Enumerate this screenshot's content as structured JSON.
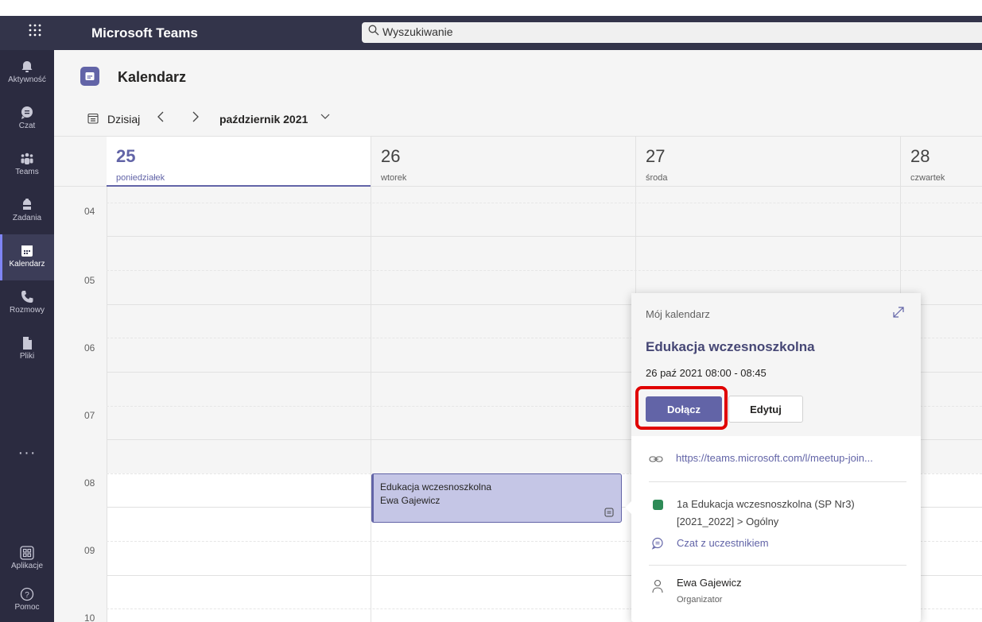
{
  "app": {
    "title": "Microsoft Teams",
    "search_placeholder": "Wyszukiwanie"
  },
  "rail": {
    "items": [
      {
        "label": "Aktywność",
        "icon": "bell-icon"
      },
      {
        "label": "Czat",
        "icon": "chat-icon"
      },
      {
        "label": "Teams",
        "icon": "teams-icon"
      },
      {
        "label": "Zadania",
        "icon": "assignments-icon"
      },
      {
        "label": "Kalendarz",
        "icon": "calendar-icon",
        "active": true
      },
      {
        "label": "Rozmowy",
        "icon": "phone-icon"
      },
      {
        "label": "Pliki",
        "icon": "file-icon"
      }
    ],
    "more": "···",
    "bottom": [
      {
        "label": "Aplikacje",
        "icon": "apps-icon"
      },
      {
        "label": "Pomoc",
        "icon": "help-icon"
      }
    ]
  },
  "page": {
    "title": "Kalendarz"
  },
  "toolbar": {
    "today_label": "Dzisiaj",
    "month_label": "październik 2021"
  },
  "days": [
    {
      "num": "25",
      "name": "poniedziałek",
      "today": true
    },
    {
      "num": "26",
      "name": "wtorek"
    },
    {
      "num": "27",
      "name": "środa"
    },
    {
      "num": "28",
      "name": "czwartek"
    }
  ],
  "hours": [
    "04",
    "05",
    "06",
    "07",
    "08",
    "09",
    "10"
  ],
  "event": {
    "title": "Edukacja wczesnoszkolna",
    "organizer": "Ewa Gajewicz"
  },
  "popup": {
    "calendar_name": "Mój kalendarz",
    "title": "Edukacja wczesnoszkolna",
    "time": "26 paź 2021 08:00 - 08:45",
    "join_label": "Dołącz",
    "edit_label": "Edytuj",
    "link": "https://teams.microsoft.com/l/meetup-join...",
    "channel_line1": "1a Edukacja wczesnoszkolna (SP Nr3)",
    "channel_line2": "[2021_2022] > Ogólny",
    "chat_label": "Czat z uczestnikiem",
    "organizer_name": "Ewa Gajewicz",
    "organizer_role": "Organizator"
  },
  "colors": {
    "brand": "#6264a7",
    "titlebar": "#33344a",
    "rail": "#2b2b40",
    "highlight": "#e00000"
  }
}
